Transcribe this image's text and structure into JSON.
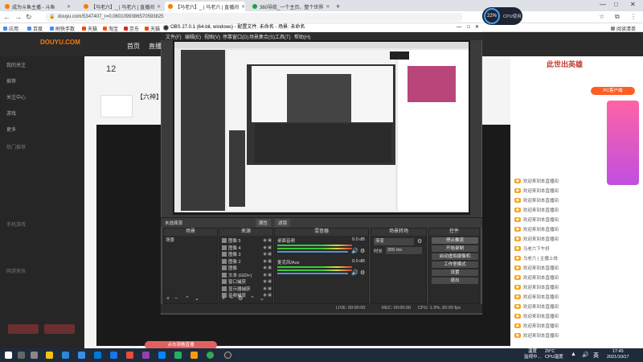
{
  "browser": {
    "tabs": [
      {
        "title": "成为斗鱼主播 - 斗鱼"
      },
      {
        "title": "【马老六】_ | 马老六 | 直播间"
      },
      {
        "title": "【马老六】_ | 马老六 | 直播间"
      },
      {
        "title": "360导航_一个主页，整个世界"
      }
    ],
    "new_tab": "+",
    "url": "douyu.com/5347407_r=0.0601099386570593825",
    "bookmarks": [
      "应用",
      "百度",
      "刷快手数",
      "天猫",
      "淘宝",
      "京东",
      "天猫",
      "阅读清单"
    ]
  },
  "cpu_gauge": {
    "value": "22%",
    "label": "CPU使用"
  },
  "douyu": {
    "logo": "DOUYU.COM",
    "nav": [
      "首页",
      "直播"
    ],
    "sidebar_items": [
      "我的关注",
      "推荐",
      "关注中心",
      "游戏",
      "更多"
    ],
    "sidebar_sections": [
      "热门推荐",
      "手机游戏",
      "网游竞技"
    ],
    "follow_count": "12",
    "room_title": "【六神】游",
    "right_banner": "此世出英雄",
    "right_promo": "PC客户端",
    "chat_lines": [
      "欢迎来到本直播间",
      "欢迎来到本直播间",
      "欢迎来到本直播间",
      "欢迎来到本直播间",
      "欢迎来到本直播间",
      "欢迎来到本直播间",
      "欢迎来到本直播间",
      "马老六下午好",
      "马老六 | 主播上线",
      "欢迎来到本直播间",
      "欢迎来到本直播间",
      "欢迎来到本直播间",
      "欢迎来到本直播间",
      "欢迎来到本直播间",
      "欢迎来到本直播间",
      "欢迎来到本直播间",
      "欢迎来到本直播间"
    ],
    "bottom_notice": "点击观看直播"
  },
  "obs": {
    "title": "OBS 27.0.1 (64-bit, windows) - 配置文件: 未命名 - 场景: 未命名",
    "menu": [
      "文件(F)",
      "编辑(E)",
      "视图(V)",
      "停靠窗口(D)",
      "场景集合(S)",
      "工具(T)",
      "帮助(H)"
    ],
    "toolbar_label": "未选择源",
    "toolbar_props": "属性",
    "toolbar_filters": "滤镜",
    "scenes_header": "场景",
    "scene_items": [
      "场景"
    ],
    "sources_header": "来源",
    "sources": [
      "图像 5",
      "图像 4",
      "图像 3",
      "图像 2",
      "图像",
      "文本 (GDI+)",
      "窗口捕获",
      "显示器捕获",
      "音频捕获"
    ],
    "mixer_header": "混音器",
    "mixer_tracks": [
      {
        "name": "桌面音频",
        "level": "0.0 dB"
      },
      {
        "name": "麦克风/Aux",
        "level": "0.0 dB"
      }
    ],
    "transition_header": "场景转场",
    "transition_type": "渐变",
    "transition_duration_label": "时长",
    "transition_duration": "300 ms",
    "controls_header": "控件",
    "controls": [
      "停止推流",
      "开始录制",
      "启动虚拟摄像机",
      "工作室模式",
      "设置",
      "退出"
    ],
    "status": {
      "live": "LIVE: 00:00:00",
      "rec": "REC: 00:00:00",
      "cpu": "CPU: 1.9%, 60.00 fps"
    }
  },
  "taskbar": {
    "weather": "29°C",
    "weather_sub": "CPU温度",
    "time": "17:45",
    "date": "2021/10/17",
    "weather_label": "温度",
    "weather_label_sub": "监视中..."
  }
}
